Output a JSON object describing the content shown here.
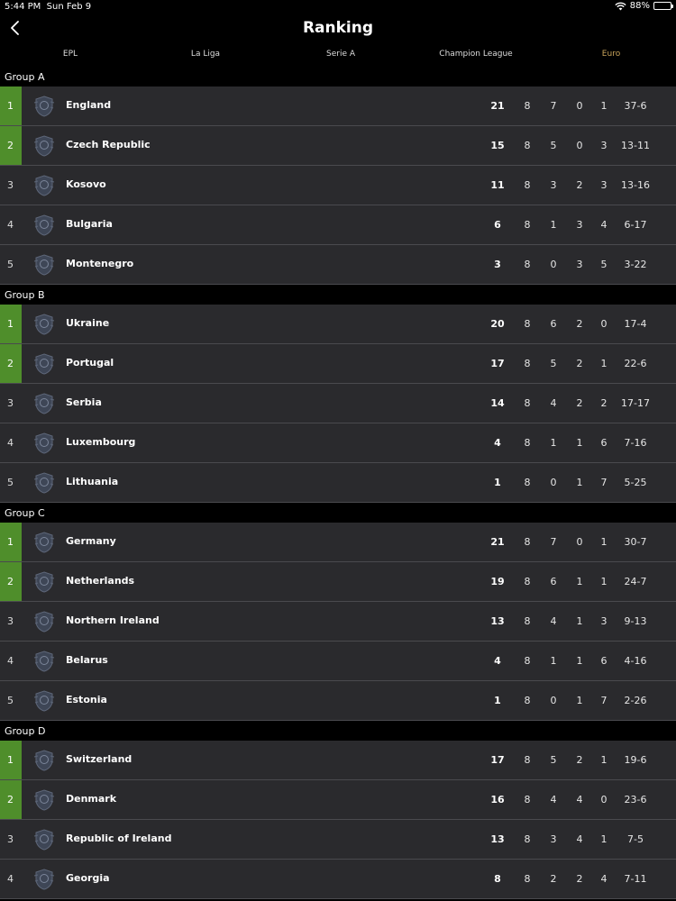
{
  "status": {
    "time": "5:44 PM",
    "date": "Sun Feb 9",
    "battery": "88%"
  },
  "nav": {
    "title": "Ranking"
  },
  "tabs": [
    {
      "label": "EPL",
      "active": false
    },
    {
      "label": "La Liga",
      "active": false
    },
    {
      "label": "Serie A",
      "active": false
    },
    {
      "label": "Champion League",
      "active": false
    },
    {
      "label": "Euro",
      "active": true
    }
  ],
  "colors": {
    "qualified": "#4f8e2b",
    "active_tab": "#c8a35a",
    "row_bg": "#2a2a2d"
  },
  "groups": [
    {
      "name": "Group A",
      "rows": [
        {
          "rank": "1",
          "qualified": true,
          "team": "England",
          "pts": "21",
          "p": "8",
          "w": "7",
          "d": "0",
          "l": "1",
          "gd": "37-6"
        },
        {
          "rank": "2",
          "qualified": true,
          "team": "Czech Republic",
          "pts": "15",
          "p": "8",
          "w": "5",
          "d": "0",
          "l": "3",
          "gd": "13-11"
        },
        {
          "rank": "3",
          "qualified": false,
          "team": "Kosovo",
          "pts": "11",
          "p": "8",
          "w": "3",
          "d": "2",
          "l": "3",
          "gd": "13-16"
        },
        {
          "rank": "4",
          "qualified": false,
          "team": "Bulgaria",
          "pts": "6",
          "p": "8",
          "w": "1",
          "d": "3",
          "l": "4",
          "gd": "6-17"
        },
        {
          "rank": "5",
          "qualified": false,
          "team": "Montenegro",
          "pts": "3",
          "p": "8",
          "w": "0",
          "d": "3",
          "l": "5",
          "gd": "3-22"
        }
      ]
    },
    {
      "name": "Group B",
      "rows": [
        {
          "rank": "1",
          "qualified": true,
          "team": "Ukraine",
          "pts": "20",
          "p": "8",
          "w": "6",
          "d": "2",
          "l": "0",
          "gd": "17-4"
        },
        {
          "rank": "2",
          "qualified": true,
          "team": "Portugal",
          "pts": "17",
          "p": "8",
          "w": "5",
          "d": "2",
          "l": "1",
          "gd": "22-6"
        },
        {
          "rank": "3",
          "qualified": false,
          "team": "Serbia",
          "pts": "14",
          "p": "8",
          "w": "4",
          "d": "2",
          "l": "2",
          "gd": "17-17"
        },
        {
          "rank": "4",
          "qualified": false,
          "team": "Luxembourg",
          "pts": "4",
          "p": "8",
          "w": "1",
          "d": "1",
          "l": "6",
          "gd": "7-16"
        },
        {
          "rank": "5",
          "qualified": false,
          "team": "Lithuania",
          "pts": "1",
          "p": "8",
          "w": "0",
          "d": "1",
          "l": "7",
          "gd": "5-25"
        }
      ]
    },
    {
      "name": "Group C",
      "rows": [
        {
          "rank": "1",
          "qualified": true,
          "team": "Germany",
          "pts": "21",
          "p": "8",
          "w": "7",
          "d": "0",
          "l": "1",
          "gd": "30-7"
        },
        {
          "rank": "2",
          "qualified": true,
          "team": "Netherlands",
          "pts": "19",
          "p": "8",
          "w": "6",
          "d": "1",
          "l": "1",
          "gd": "24-7"
        },
        {
          "rank": "3",
          "qualified": false,
          "team": "Northern Ireland",
          "pts": "13",
          "p": "8",
          "w": "4",
          "d": "1",
          "l": "3",
          "gd": "9-13"
        },
        {
          "rank": "4",
          "qualified": false,
          "team": "Belarus",
          "pts": "4",
          "p": "8",
          "w": "1",
          "d": "1",
          "l": "6",
          "gd": "4-16"
        },
        {
          "rank": "5",
          "qualified": false,
          "team": "Estonia",
          "pts": "1",
          "p": "8",
          "w": "0",
          "d": "1",
          "l": "7",
          "gd": "2-26"
        }
      ]
    },
    {
      "name": "Group D",
      "rows": [
        {
          "rank": "1",
          "qualified": true,
          "team": "Switzerland",
          "pts": "17",
          "p": "8",
          "w": "5",
          "d": "2",
          "l": "1",
          "gd": "19-6"
        },
        {
          "rank": "2",
          "qualified": true,
          "team": "Denmark",
          "pts": "16",
          "p": "8",
          "w": "4",
          "d": "4",
          "l": "0",
          "gd": "23-6"
        },
        {
          "rank": "3",
          "qualified": false,
          "team": "Republic of Ireland",
          "pts": "13",
          "p": "8",
          "w": "3",
          "d": "4",
          "l": "1",
          "gd": "7-5"
        },
        {
          "rank": "4",
          "qualified": false,
          "team": "Georgia",
          "pts": "8",
          "p": "8",
          "w": "2",
          "d": "2",
          "l": "4",
          "gd": "7-11"
        }
      ]
    }
  ]
}
